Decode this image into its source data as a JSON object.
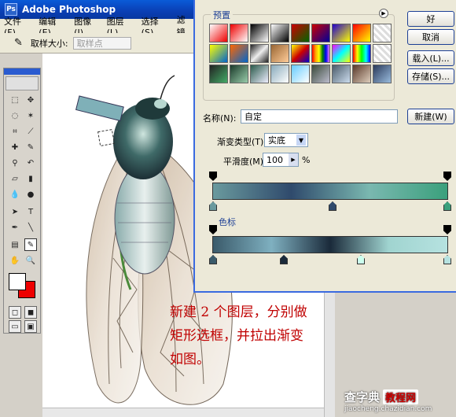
{
  "app": {
    "title": "Adobe Photoshop",
    "logo_text": "Ps"
  },
  "menu": [
    "文件(F)",
    "编辑(E)",
    "图像(I)",
    "图层(L)",
    "选择(S)",
    "滤镜"
  ],
  "options_bar": {
    "sample_size_label": "取样大小:",
    "sample_size_value": "取样点"
  },
  "dialog": {
    "presets_label": "预置",
    "buttons": {
      "ok": "好",
      "cancel": "取消",
      "load": "载入(L)...",
      "save": "存储(S)...",
      "new": "新建(W)"
    },
    "name_label": "名称(N):",
    "name_value": "自定",
    "gradient_type_label": "渐变类型(T):",
    "gradient_type_value": "实底",
    "smoothness_label": "平滑度(M):",
    "smoothness_value": "100",
    "smoothness_unit": "%",
    "section_label": "色标",
    "gradient1": [
      "#6a9a9e",
      "#2f4a6c",
      "#7ab8b0",
      "#3aa07c"
    ],
    "gradient2": [
      "#3a5a6a",
      "#7fb0c0",
      "#1a2a3a",
      "#a0d4d0",
      "#b6e2e0"
    ]
  },
  "caption": [
    "新建 2 个图层，分别做",
    "矩形选框，并拉出渐变",
    "如图。"
  ],
  "watermark": {
    "site": "查字典",
    "section": "教程网",
    "url": "jiaocheng.chazidian.com"
  }
}
